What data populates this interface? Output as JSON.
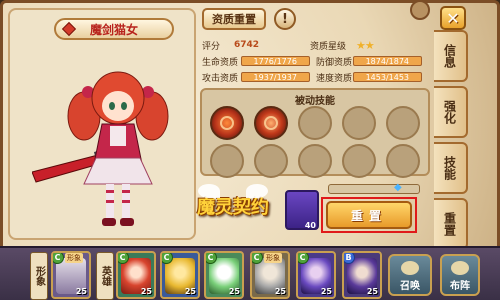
{
  "hero": {
    "name": "魔剑猫女"
  },
  "header": {
    "qualify_reset_label": "资质重置",
    "info_label": "!",
    "close_label": "✕"
  },
  "stats": {
    "score_label": "评分",
    "score_value": "6742",
    "star_label": "资质星级",
    "stars": "★★",
    "hp_label": "生命资质",
    "hp_value": "1776/1776",
    "def_label": "防御资质",
    "def_value": "1874/1874",
    "atk_label": "攻击资质",
    "atk_value": "1937/1937",
    "spd_label": "速度资质",
    "spd_value": "1453/1453"
  },
  "skills": {
    "title": "被动技能"
  },
  "book": {
    "count": "40"
  },
  "reset_button": {
    "label": "重置"
  },
  "side_tabs": [
    "信息",
    "强化",
    "技能",
    "重置"
  ],
  "logo": {
    "text": "魔灵契约"
  },
  "bottom": {
    "tab_left": "形象",
    "tab_mid": "英雄",
    "slots": [
      {
        "grade": "C",
        "tag": "形象",
        "level": "25"
      },
      {
        "grade": "C",
        "tag": "",
        "level": "25"
      },
      {
        "grade": "C",
        "tag": "",
        "level": "25"
      },
      {
        "grade": "C",
        "tag": "",
        "level": "25"
      },
      {
        "grade": "C",
        "tag": "形象",
        "level": "25"
      },
      {
        "grade": "C",
        "tag": "",
        "level": "25"
      },
      {
        "grade": "B",
        "tag": "",
        "level": "25"
      }
    ],
    "summon_label": "召唤",
    "formation_label": "布阵"
  }
}
